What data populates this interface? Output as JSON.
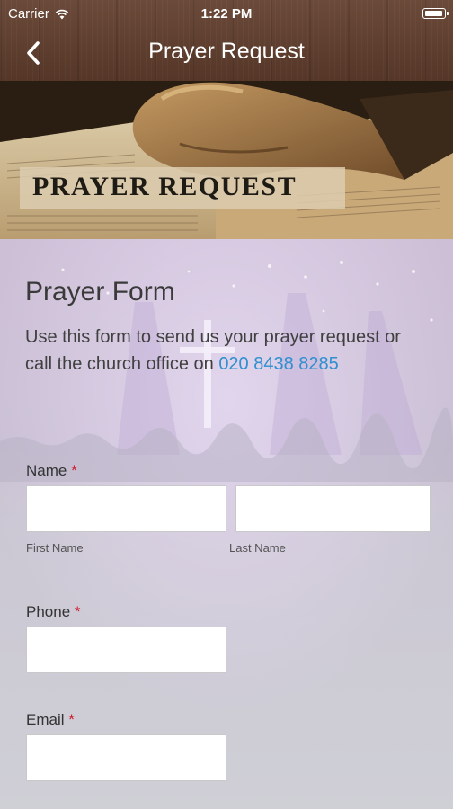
{
  "status_bar": {
    "carrier": "Carrier",
    "time": "1:22 PM"
  },
  "nav": {
    "title": "Prayer Request",
    "back_icon": "chevron-left-icon"
  },
  "banner": {
    "title": "PRAYER REQUEST"
  },
  "form": {
    "title": "Prayer Form",
    "intro": "Use this form to send us your prayer request or call the church office on ",
    "phone": "020 8438 8285",
    "required_marker": "*",
    "name": {
      "label": "Name",
      "first_sublabel": "First Name",
      "last_sublabel": "Last Name",
      "first_value": "",
      "last_value": ""
    },
    "phone_field": {
      "label": "Phone",
      "value": ""
    },
    "email_field": {
      "label": "Email",
      "value": ""
    }
  },
  "colors": {
    "nav_brown": "#5e3f30",
    "link_blue": "#2f8fcf",
    "required_red": "#d0192a"
  }
}
